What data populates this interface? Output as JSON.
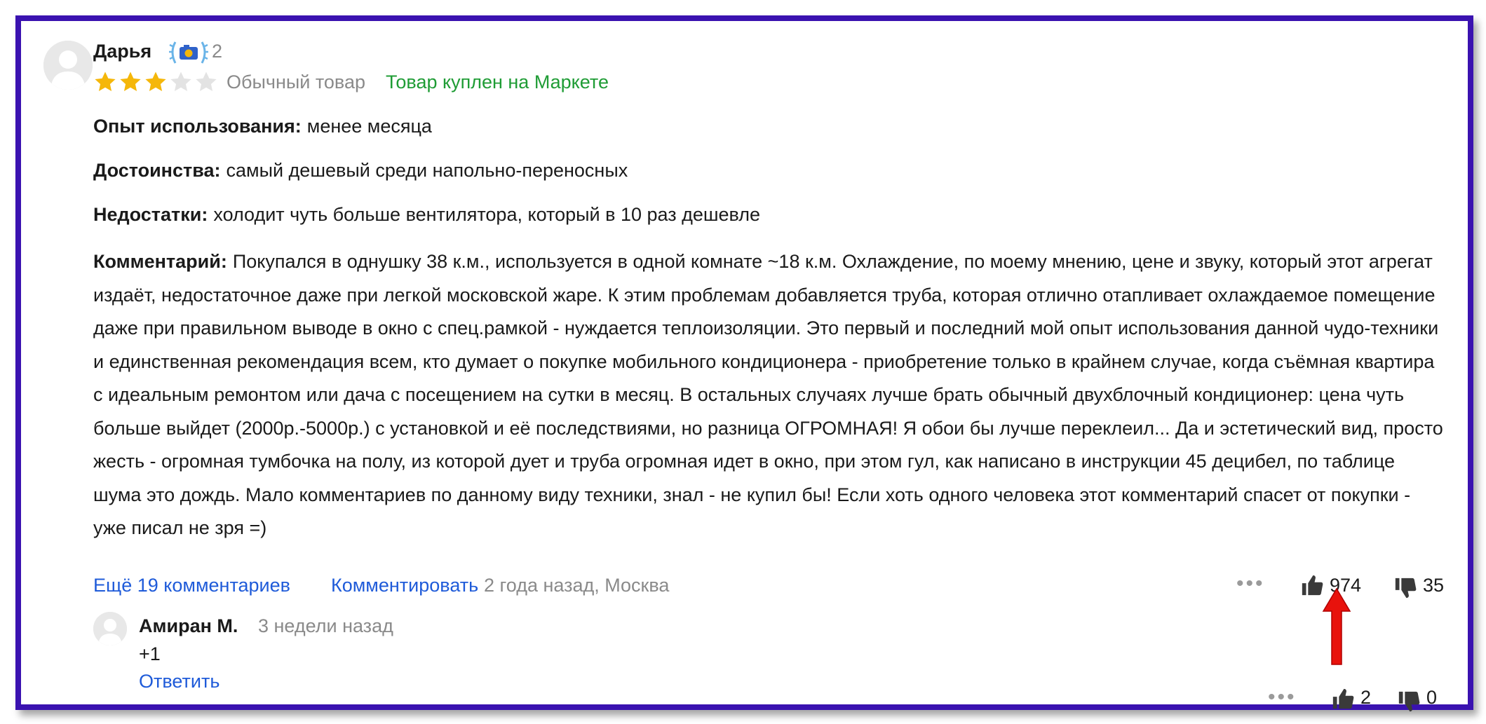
{
  "review": {
    "author": "Дарья",
    "badge_count": "2",
    "rating": 3,
    "rating_max": 5,
    "product_type": "Обычный товар",
    "purchase_status": "Товар куплен на Маркете",
    "experience_label": "Опыт использования:",
    "experience_value": "менее месяца",
    "pros_label": "Достоинства:",
    "pros_value": "самый дешевый среди напольно-переносных",
    "cons_label": "Недостатки:",
    "cons_value": "холодит чуть больше вентилятора, который в 10 раз дешевле",
    "comment_label": "Комментарий:",
    "comment_value": "Покупался в однушку 38 к.м., используется в одной комнате ~18 к.м. Охлаждение, по моему мнению, цене и звуку, который этот агрегат издаёт, недостаточное даже при легкой московской жаре. К этим проблемам добавляется труба, которая отлично отапливает охлаждаемое помещение даже при правильном выводе в окно с спец.рамкой - нуждается теплоизоляции. Это первый и последний мой опыт использования данной чудо-техники и единственная рекомендация всем, кто думает о покупке мобильного кондиционера - приобретение только в крайнем случае, когда съёмная квартира с идеальным ремонтом или дача с посещением на сутки в месяц. В остальных случаях лучше брать обычный двухблочный кондиционер: цена чуть больше выйдет (2000р.-5000р.) с установкой и её последствиями, но разница ОГРОМНАЯ! Я обои бы лучше переклеил... Да и эстетический вид, просто жесть - огромная тумбочка на полу, из которой дует и труба огромная идет в окно, при этом гул, как написано в инструкции 45 децибел, по таблице шума это дождь. Мало комментариев по данному виду техники, знал - не купил бы! Если хоть одного человека этот комментарий спасет от покупки - уже писал не зря =)",
    "more_comments": "Ещё 19 комментариев",
    "comment_action": "Комментировать",
    "meta": "2 года назад, Москва",
    "likes": "974",
    "dislikes": "35"
  },
  "reply": {
    "author": "Амиран М.",
    "date": "3 недели назад",
    "text": "+1",
    "action": "Ответить",
    "likes": "2",
    "dislikes": "0"
  },
  "colors": {
    "frame": "#3a12b0",
    "star_filled": "#f5b70a",
    "star_empty": "#e3e3e3",
    "link": "#1f5bd9",
    "bought": "#1f9c35",
    "muted": "#8a8a8a",
    "arrow": "#e8120c"
  },
  "icons": {
    "avatar": "user-silhouette-icon",
    "badge": "laurel-camera-badge-icon",
    "like": "thumbs-up-icon",
    "dislike": "thumbs-down-icon",
    "more": "more-dots-icon",
    "annotation": "red-arrow-icon"
  }
}
